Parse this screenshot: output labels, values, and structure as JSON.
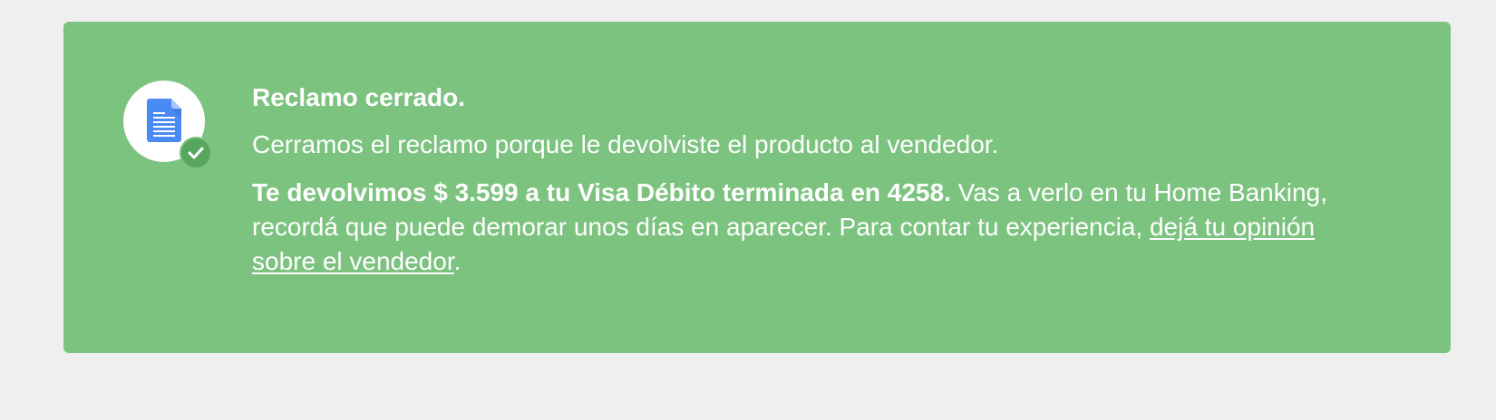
{
  "notice": {
    "title": "Reclamo cerrado.",
    "subtitle": "Cerramos el reclamo porque le devolviste el producto al vendedor.",
    "refund_bold": "Te devolvimos $ 3.599 a tu Visa Débito terminada en 4258.",
    "refund_text": " Vas a verlo en tu Home Banking, recordá que puede demorar unos días en aparecer. Para contar tu experiencia, ",
    "review_link": "dejá tu opinión sobre el vendedor",
    "trailing_period": "."
  },
  "icons": {
    "main": "document-icon",
    "badge": "check-icon"
  },
  "colors": {
    "page_background": "#efefef",
    "banner_background": "#7dc380",
    "badge": "#58a65d",
    "document": "#4a8af4",
    "text": "#ffffff"
  }
}
